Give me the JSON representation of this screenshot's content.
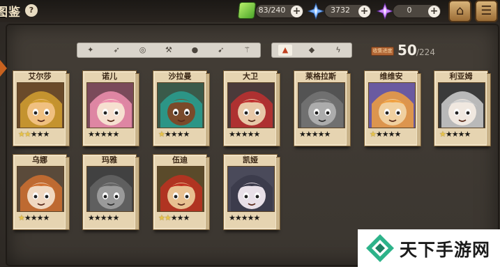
{
  "header": {
    "title": "图鉴",
    "help_icon": "?"
  },
  "resources": [
    {
      "icon": "stamina-icon",
      "value": "83/240"
    },
    {
      "icon": "blue-crystal-icon",
      "value": "3732"
    },
    {
      "icon": "purple-crystal-icon",
      "value": "0"
    }
  ],
  "plus_label": "+",
  "top_buttons": {
    "home_icon": "⌂",
    "menu_icon": "☰"
  },
  "class_filters": [
    "sword-icon",
    "spear-icon",
    "shield-icon",
    "hammer-icon",
    "helmet-icon",
    "bow-icon",
    "staff-icon"
  ],
  "element_filters": [
    {
      "icon": "fire-icon",
      "active": true
    },
    {
      "icon": "water-icon",
      "active": false
    },
    {
      "icon": "lightning-icon",
      "active": false
    }
  ],
  "collection": {
    "label": "收集进度",
    "count": "50",
    "total": "/224"
  },
  "heroes": [
    {
      "name": "艾尔莎",
      "stars": 2,
      "owned": true
    },
    {
      "name": "诺儿",
      "stars": 0,
      "owned": true
    },
    {
      "name": "沙拉曼",
      "stars": 1,
      "owned": true
    },
    {
      "name": "大卫",
      "stars": 0,
      "owned": true
    },
    {
      "name": "莱格拉斯",
      "stars": 0,
      "owned": false
    },
    {
      "name": "维维安",
      "stars": 1,
      "owned": true
    },
    {
      "name": "利亚姆",
      "stars": 1,
      "owned": true
    },
    {
      "name": "乌娜",
      "stars": 1,
      "owned": true
    },
    {
      "name": "玛雅",
      "stars": 0,
      "owned": false
    },
    {
      "name": "伍迪",
      "stars": 2,
      "owned": true
    },
    {
      "name": "凯娅",
      "stars": 0,
      "owned": true
    }
  ],
  "watermark": {
    "text": "天下手游网"
  }
}
